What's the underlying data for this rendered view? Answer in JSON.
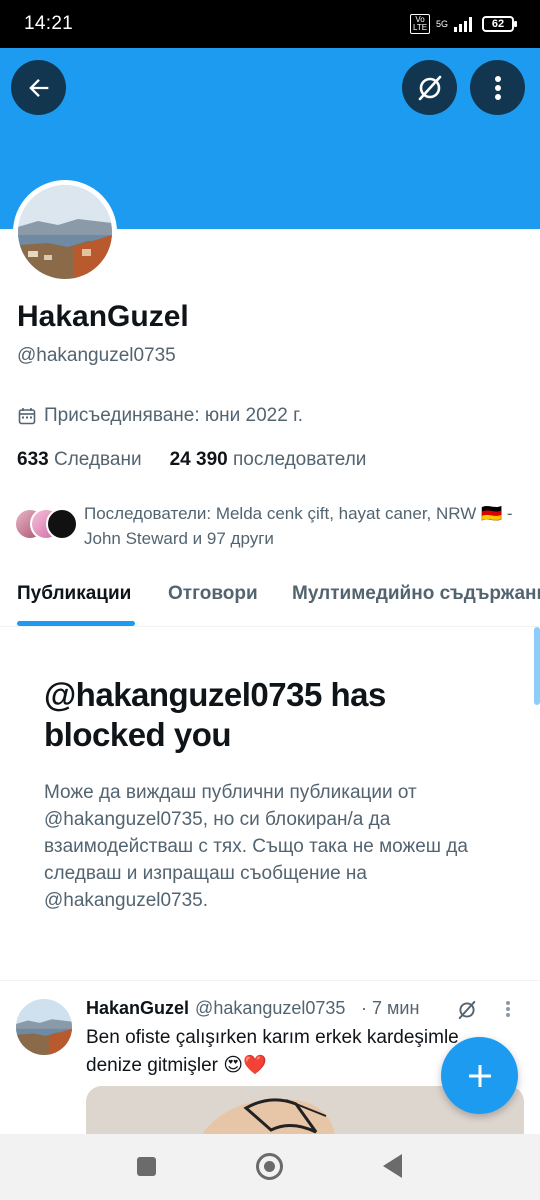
{
  "status_bar": {
    "time": "14:21",
    "volte_label": "Vo LTE",
    "network_label": "5G",
    "battery": "62",
    "icons": [
      "volte-icon",
      "network-5g-icon",
      "signal-icon",
      "battery-icon"
    ]
  },
  "colors": {
    "brand": "#1d9bf0",
    "text_primary": "#0f1419",
    "text_secondary": "#536471",
    "divider": "#eff3f4"
  },
  "header": {
    "icons": [
      "back-arrow-icon",
      "grok-icon",
      "more-vertical-icon"
    ]
  },
  "profile": {
    "display_name": "HakanGuzel",
    "handle": "@hakanguzel0735",
    "joined": "Присъединяване: юни 2022 г.",
    "following_count": "633",
    "following_label": "Следвани",
    "followers_count": "24 390",
    "followers_label": "последователи",
    "followers_you_know": "Последователи: Melda cenk çift, hayat caner, NRW 🇩🇪 - John Steward и 97 други"
  },
  "tabs": [
    {
      "label": "Публикации",
      "active": true
    },
    {
      "label": "Отговори",
      "active": false
    },
    {
      "label": "Мултимедийно съдържание",
      "active": false
    }
  ],
  "blocked": {
    "title": "@hakanguzel0735 has blocked you",
    "body": "Може да виждаш публични публикации от @hakanguzel0735, но си блокиран/а да взаимодействаш с тях. Също така не можеш да следваш и изпращаш съобщение на @hakanguzel0735."
  },
  "tweet": {
    "name": "HakanGuzel",
    "handle": "@hakanguzel0735",
    "time": "· 7 мин",
    "text": "Ben ofiste çalışırken karım erkek kardeşimle denize gitmişler 😍❤️"
  },
  "fab": {
    "icon": "plus-icon"
  },
  "nav_bar": {
    "icons": [
      "recents-square-icon",
      "home-circle-icon",
      "back-triangle-icon"
    ]
  }
}
